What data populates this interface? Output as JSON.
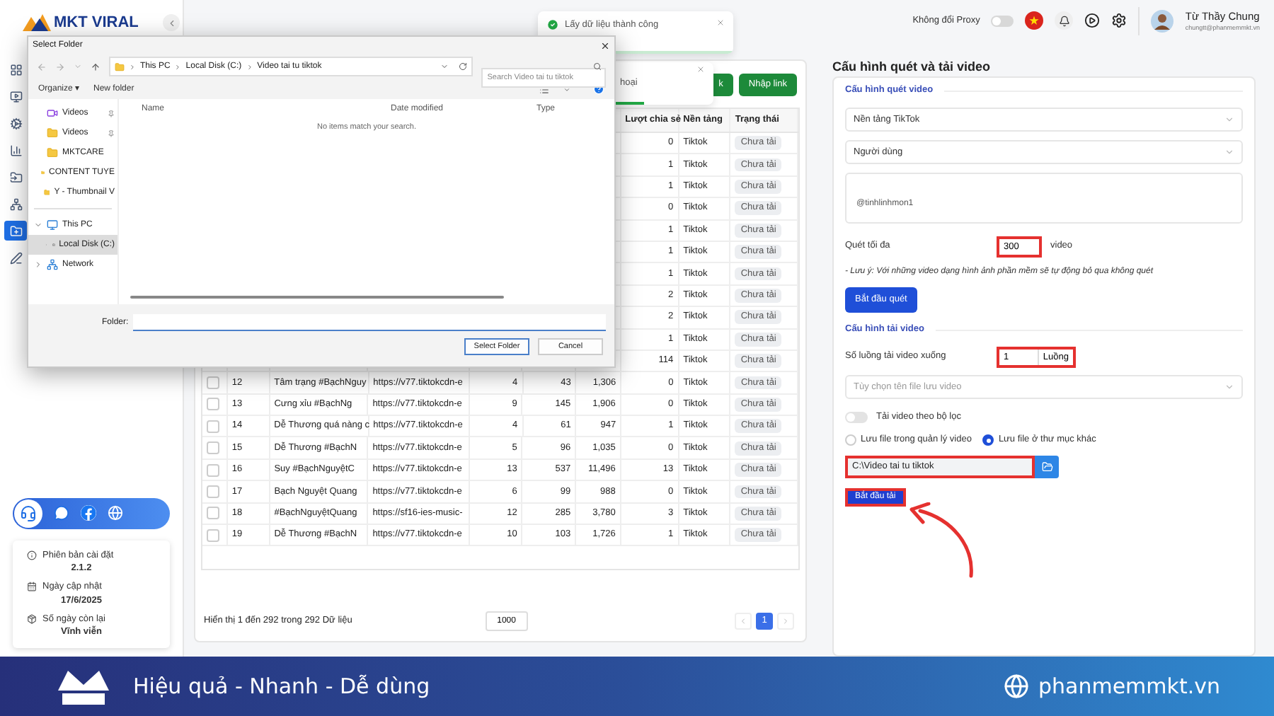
{
  "app": {
    "logo": "MKT VIRAL"
  },
  "sidebar": {
    "nav": [
      {
        "selected": false
      },
      {
        "selected": false
      },
      {
        "selected": false
      },
      {
        "selected": false
      },
      {
        "selected": false
      },
      {
        "selected": false
      },
      {
        "selected": true
      },
      {
        "selected": false
      }
    ],
    "info": [
      {
        "label": "Phiên bản cài đặt",
        "value": "2.1.2"
      },
      {
        "label": "Ngày cập nhật",
        "value": "17/6/2025"
      },
      {
        "label": "Số ngày còn lại",
        "value": "Vĩnh viễn"
      }
    ]
  },
  "header": {
    "proxy": {
      "label": "Không đổi Proxy",
      "on": false
    },
    "user": {
      "name": "Từ Thầy Chung",
      "email": "chungtt@phanmemmkt.vn"
    }
  },
  "toasts": [
    {
      "text": "Lấy dữ liệu thành công"
    },
    {
      "text": "hoại"
    }
  ],
  "toolbar": {
    "buttons": [
      "k",
      "Nhập link"
    ]
  },
  "table": {
    "columns": [
      "Lượt chia sẻ",
      "Nền tảng",
      "Trạng thái"
    ],
    "rows": [
      {
        "share": "0",
        "platform": "Tiktok",
        "status": "Chưa tải"
      },
      {
        "share": "1",
        "platform": "Tiktok",
        "status": "Chưa tải"
      },
      {
        "share": "1",
        "platform": "Tiktok",
        "status": "Chưa tải"
      },
      {
        "share": "0",
        "platform": "Tiktok",
        "status": "Chưa tải"
      },
      {
        "share": "1",
        "platform": "Tiktok",
        "status": "Chưa tải"
      },
      {
        "share": "1",
        "platform": "Tiktok",
        "status": "Chưa tải"
      },
      {
        "share": "1",
        "platform": "Tiktok",
        "status": "Chưa tải"
      },
      {
        "share": "2",
        "platform": "Tiktok",
        "status": "Chưa tải"
      },
      {
        "share": "2",
        "platform": "Tiktok",
        "status": "Chưa tải"
      },
      {
        "share": "1",
        "platform": "Tiktok",
        "status": "Chưa tải"
      },
      {
        "share": "114",
        "platform": "Tiktok",
        "status": "Chưa tải"
      },
      {
        "checked": false,
        "index": "12",
        "title": "Tâm trạng #BạchNguy",
        "link": "https://v77.tiktokcdn-e",
        "column_4": "4",
        "column_5": "43",
        "column_6": "1,306",
        "share": "0",
        "platform": "Tiktok",
        "status": "Chưa tải"
      },
      {
        "checked": false,
        "index": "13",
        "title": "Cưng xỉu #BạchNg",
        "link": "https://v77.tiktokcdn-e",
        "column_4": "9",
        "column_5": "145",
        "column_6": "1,906",
        "share": "0",
        "platform": "Tiktok",
        "status": "Chưa tải"
      },
      {
        "checked": false,
        "index": "14",
        "title": "Dễ Thương quá nàng c",
        "link": "https://v77.tiktokcdn-e",
        "column_4": "4",
        "column_5": "61",
        "column_6": "947",
        "share": "1",
        "platform": "Tiktok",
        "status": "Chưa tải"
      },
      {
        "checked": false,
        "index": "15",
        "title": "Dễ Thương #BạchN",
        "link": "https://v77.tiktokcdn-e",
        "column_4": "5",
        "column_5": "96",
        "column_6": "1,035",
        "share": "0",
        "platform": "Tiktok",
        "status": "Chưa tải"
      },
      {
        "checked": false,
        "index": "16",
        "title": "Suy #BạchNguyệtC",
        "link": "https://v77.tiktokcdn-e",
        "column_4": "13",
        "column_5": "537",
        "column_6": "11,496",
        "share": "13",
        "platform": "Tiktok",
        "status": "Chưa tải"
      },
      {
        "checked": false,
        "index": "17",
        "title": "Bạch Nguyệt Quang",
        "link": "https://v77.tiktokcdn-e",
        "column_4": "6",
        "column_5": "99",
        "column_6": "988",
        "share": "0",
        "platform": "Tiktok",
        "status": "Chưa tải"
      },
      {
        "checked": false,
        "index": "18",
        "title": "#BạchNguyệtQuang",
        "link": "https://sf16-ies-music-",
        "column_4": "12",
        "column_5": "285",
        "column_6": "3,780",
        "share": "3",
        "platform": "Tiktok",
        "status": "Chưa tải"
      },
      {
        "checked": false,
        "index": "19",
        "title": "Dễ Thương #BạchN",
        "link": "https://v77.tiktokcdn-e",
        "column_4": "10",
        "column_5": "103",
        "column_6": "1,726",
        "share": "1",
        "platform": "Tiktok",
        "status": "Chưa tải"
      }
    ],
    "footer": {
      "summary": "Hiển thị 1 đến 292 trong 292 Dữ liệu",
      "page_size": "1000",
      "pages": [
        {
          "label": "1",
          "selected": true
        }
      ]
    }
  },
  "dialog": {
    "title": "Select Folder",
    "path": [
      "This PC",
      "Local Disk (C:)",
      "Video tai tu tiktok"
    ],
    "search": {
      "placeholder": "Search Video tai tu tiktok"
    },
    "toolbar": [
      "Organize ▾",
      "New folder"
    ],
    "tree": [
      {
        "kind": "videos",
        "label": "Videos",
        "pinned": true
      },
      {
        "kind": "folder",
        "label": "Videos",
        "pinned": true
      },
      {
        "kind": "folder",
        "label": "MKTCARE",
        "pinned": false
      },
      {
        "kind": "folder",
        "label": "CONTENT TUYE",
        "pinned": false
      },
      {
        "kind": "folder",
        "label": "Y - Thumbnail V",
        "pinned": false
      },
      {
        "kind": "pc",
        "label": "This PC",
        "expanded": true,
        "selected": false,
        "children": [
          {
            "kind": "disk",
            "label": "Local Disk (C:)",
            "selected": true
          }
        ]
      },
      {
        "kind": "network",
        "label": "Network",
        "expanded": false,
        "selected": false
      }
    ],
    "columns": [
      "Name",
      "Date modified",
      "Type"
    ],
    "empty": "No items match your search.",
    "folder": {
      "label": "Folder:"
    },
    "buttons": [
      "Select Folder",
      "Cancel"
    ]
  },
  "config": {
    "title": "Cấu hình quét và tải video",
    "scan": {
      "heading": "Cấu hình quét video",
      "platform": "Nền tảng TikTok",
      "source": "Người dùng",
      "accounts": "@tinhlinhmon1",
      "max": {
        "label": "Quét tối đa",
        "value": "300",
        "unit": "video",
        "highlighted": true
      },
      "note": "- Lưu ý: Với những video dạng hình ảnh phần mềm sẽ tự động bỏ qua không quét",
      "button": "Bắt đầu quét"
    },
    "download": {
      "heading": "Cấu hình tải video",
      "threads": {
        "label": "Số luồng tải video xuống",
        "value": "1",
        "unit": "Luồng",
        "highlighted": true
      },
      "filename": {
        "placeholder": "Tùy chọn tên file lưu video"
      },
      "filter": {
        "label": "Tải video theo bộ lọc",
        "on": false
      },
      "save_options": [
        {
          "label": "Lưu file trong quản lý video",
          "selected": false
        },
        {
          "label": "Lưu file ở thư mục khác",
          "selected": true
        }
      ],
      "path": {
        "value": "C:\\Video tai tu tiktok",
        "highlighted": true
      },
      "button": {
        "label": "Bắt đầu tải",
        "highlighted": true
      }
    }
  },
  "banner": {
    "slogan": "Hiệu quả - Nhanh - Dễ dùng",
    "site": "phanmemmkt.vn"
  }
}
